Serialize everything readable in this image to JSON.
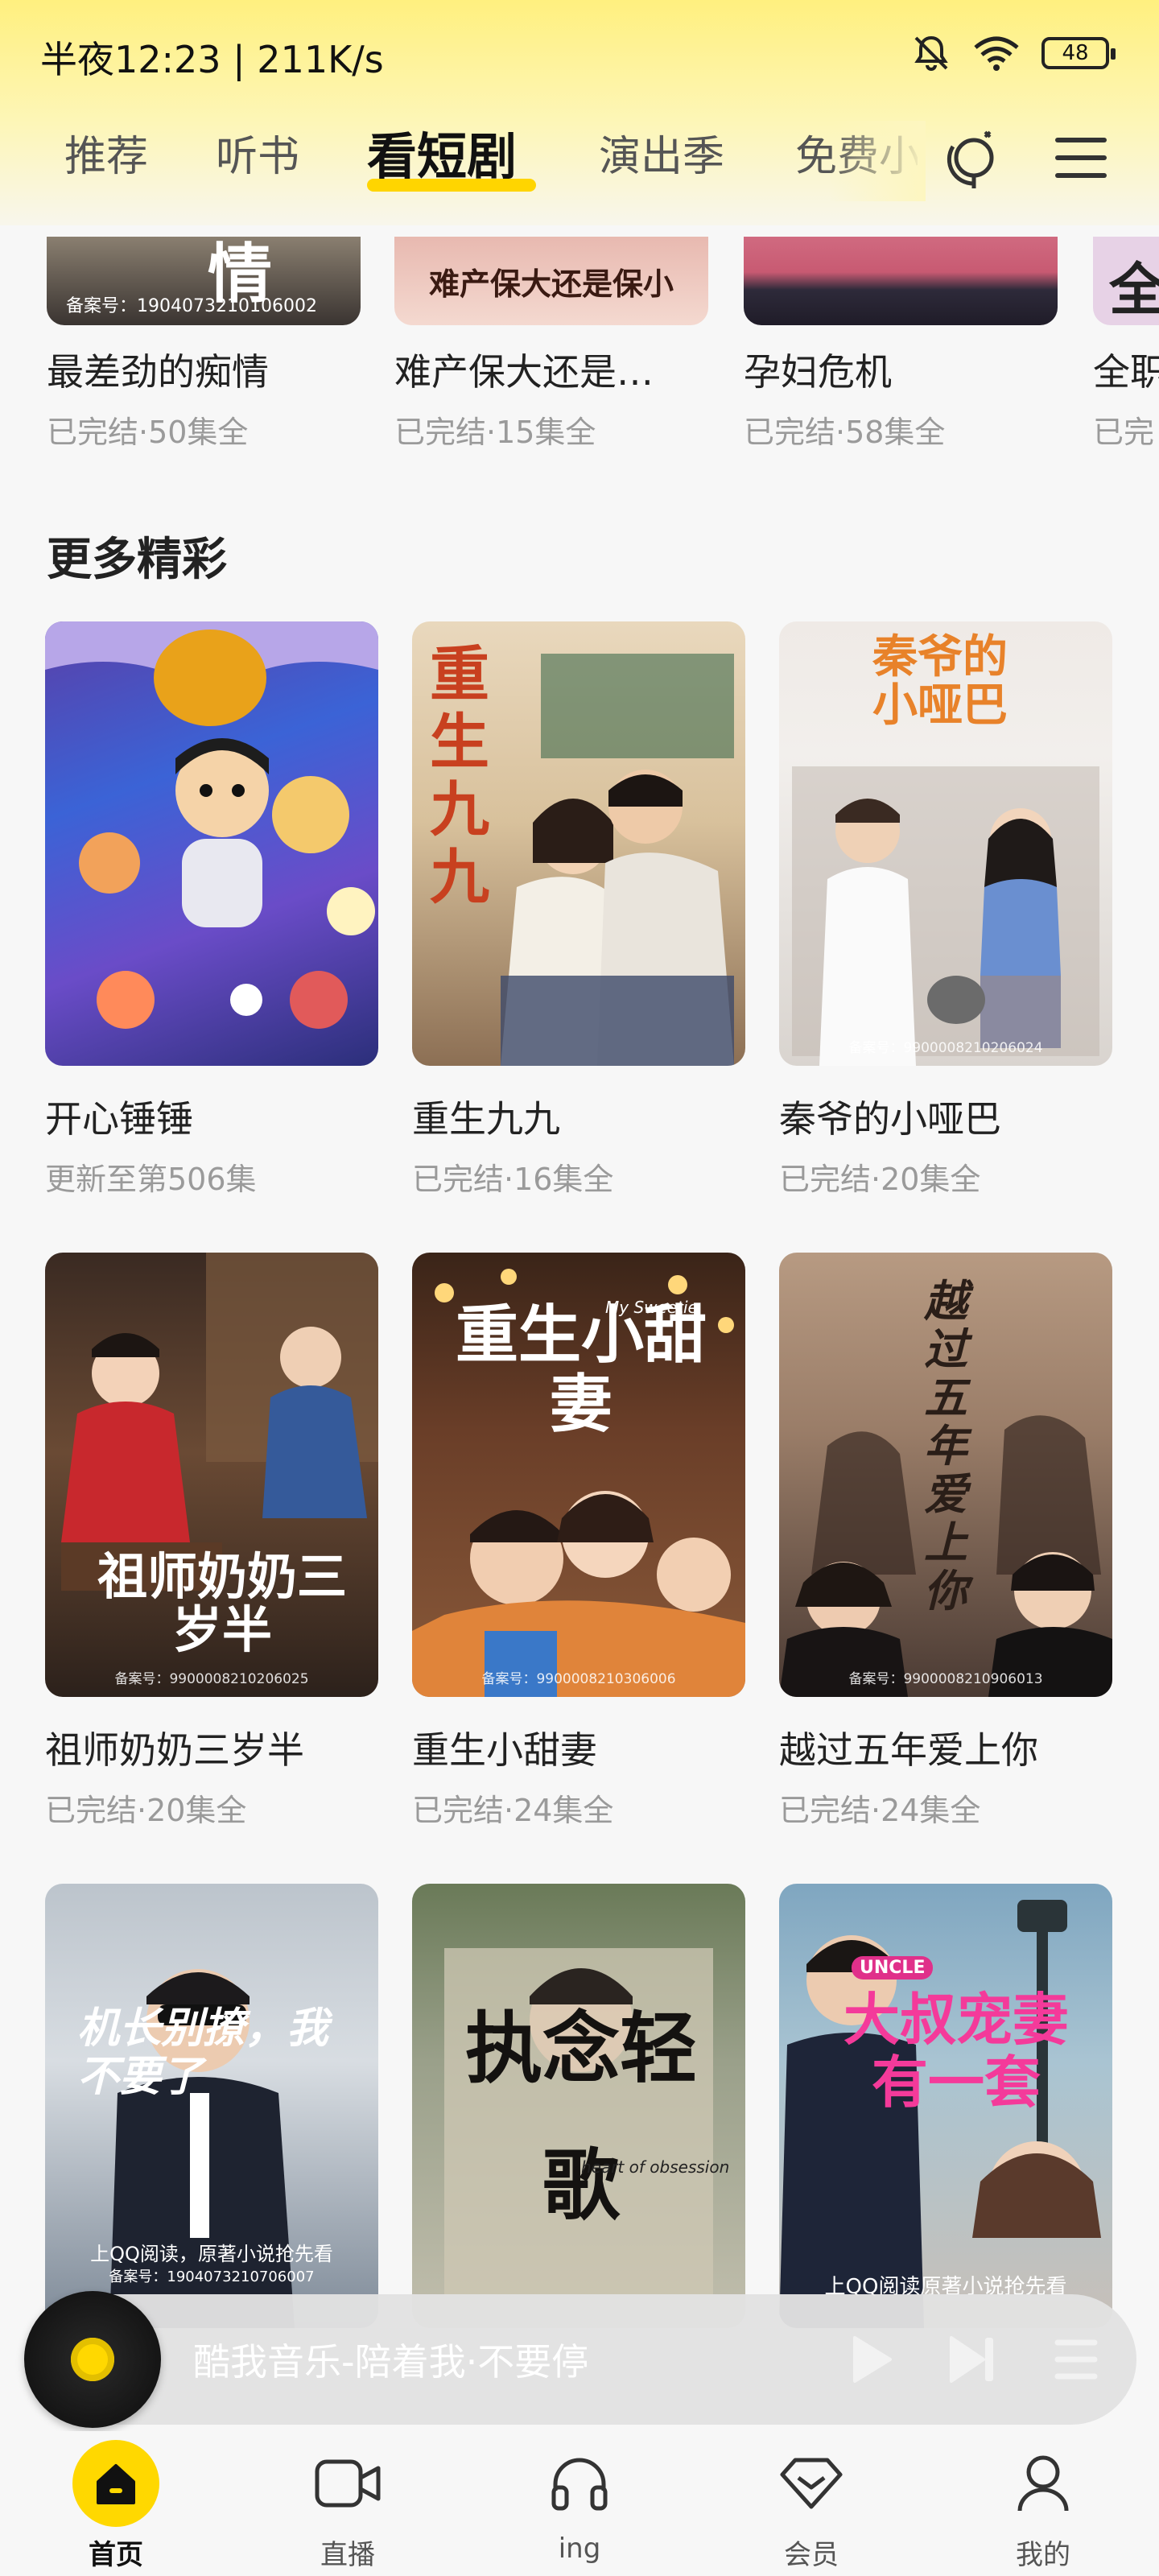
{
  "status_bar": {
    "time": "半夜12:23 | 211K/s",
    "battery": "48"
  },
  "tabs": [
    {
      "label": "推荐"
    },
    {
      "label": "听书"
    },
    {
      "label": "看短剧"
    },
    {
      "label": "演出季"
    },
    {
      "label": "免费小"
    }
  ],
  "top_row": [
    {
      "title": "最差劲的痴情",
      "status": "已完结·50集全",
      "poster_reg": "备案号：1904073210106002",
      "poster_text": "情"
    },
    {
      "title": "难产保大还是…",
      "status": "已完结·15集全",
      "poster_text": "难产保大还是保小"
    },
    {
      "title": "孕妇危机",
      "status": "已完结·58集全"
    },
    {
      "title": "全职",
      "status": "已完",
      "poster_text": "全"
    }
  ],
  "section_title": "更多精彩",
  "grid": [
    {
      "title": "开心锤锤",
      "status": "更新至第506集"
    },
    {
      "title": "重生九九",
      "status": "已完结·16集全",
      "poster_text": "重生九九"
    },
    {
      "title": "秦爷的小哑巴",
      "status": "已完结·20集全",
      "poster_text": "秦爷的小哑巴",
      "poster_reg": "备案号：9900008210206024"
    },
    {
      "title": "祖师奶奶三岁半",
      "status": "已完结·20集全",
      "poster_text": "祖师奶奶三岁半",
      "poster_reg": "备案号：9900008210206025"
    },
    {
      "title": "重生小甜妻",
      "status": "已完结·24集全",
      "poster_text": "重生小甜妻",
      "poster_sub": "My Sweetie",
      "poster_reg": "备案号：9900008210306006"
    },
    {
      "title": "越过五年爱上你",
      "status": "已完结·24集全",
      "poster_text": "越过五年爱上你",
      "poster_reg": "备案号：9900008210906013"
    },
    {
      "poster_text": "机长别撩，我不要了",
      "poster_note": "上QQ阅读，原著小说抢先看",
      "poster_reg": "备案号：1904073210706007"
    },
    {
      "poster_text": "执念轻歌",
      "poster_sub": "heart of obsession"
    },
    {
      "poster_text": "大叔宠妻有一套",
      "poster_sub": "UNCLE",
      "poster_note": "上QQ阅读原著小说抢先看"
    }
  ],
  "player": {
    "text": "酷我音乐-陪着我·不要停"
  },
  "nav": [
    {
      "label": "首页"
    },
    {
      "label": "直播"
    },
    {
      "label": "ing"
    },
    {
      "label": "会员"
    },
    {
      "label": "我的"
    }
  ],
  "colors": {
    "accent": "#ffd800",
    "header_top": "#fff07f",
    "muted_text": "#9a9a9a"
  }
}
